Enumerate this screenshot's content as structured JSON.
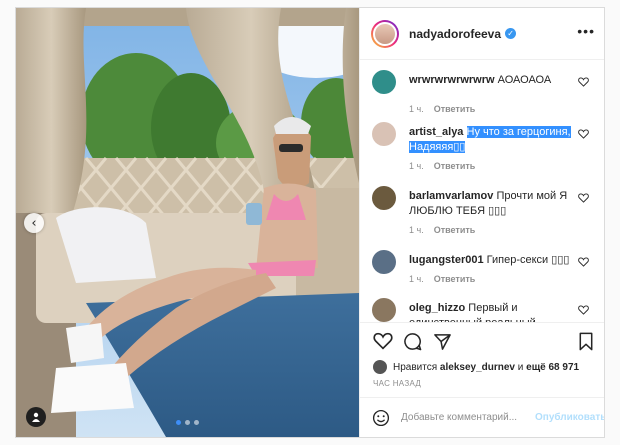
{
  "post": {
    "username": "nadyadorofeeva",
    "verified_mark": "✓",
    "more_symbol": "•••"
  },
  "carousel": {
    "prev_arrow": "‹",
    "dots_total": 3,
    "active_dot_index": 0
  },
  "comments": [
    {
      "user": "wrwrwrwrwrwrw",
      "text": "АОАОАОА",
      "time": "1 ч.",
      "reply": "Ответить",
      "highlighted": false
    },
    {
      "user": "artist_alya",
      "text": "Ну что за герцогиня, Надяяяя",
      "time": "1 ч.",
      "reply": "Ответить",
      "highlighted": true
    },
    {
      "user": "barlamvarlamov",
      "text": "Прочти мой Я ЛЮБЛЮ ТЕБЯ",
      "time": "1 ч.",
      "reply": "Ответить",
      "highlighted": false
    },
    {
      "user": "lugangster001",
      "text": "Гипер-секси",
      "time": "1 ч.",
      "reply": "Ответить",
      "highlighted": false
    },
    {
      "user": "oleg_hizzo",
      "text": "Первый и единственный реальный",
      "time": "",
      "reply": "",
      "highlighted": false
    }
  ],
  "likes": {
    "prefix": "Нравится",
    "user": "aleksey_durnev",
    "conj": "и",
    "count": "ещё 68 971"
  },
  "posted_time": "ЧАС НАЗАД",
  "add_comment": {
    "placeholder": "Добавьте комментарий...",
    "publish": "Опубликовать"
  },
  "icons": [
    "heart-icon",
    "comment-icon",
    "share-icon",
    "bookmark-icon",
    "emoji-icon",
    "user-tag-icon"
  ],
  "colors": {
    "accent": "#3897f0",
    "highlight": "#3390ff",
    "publish_disabled": "#b2dffc"
  }
}
